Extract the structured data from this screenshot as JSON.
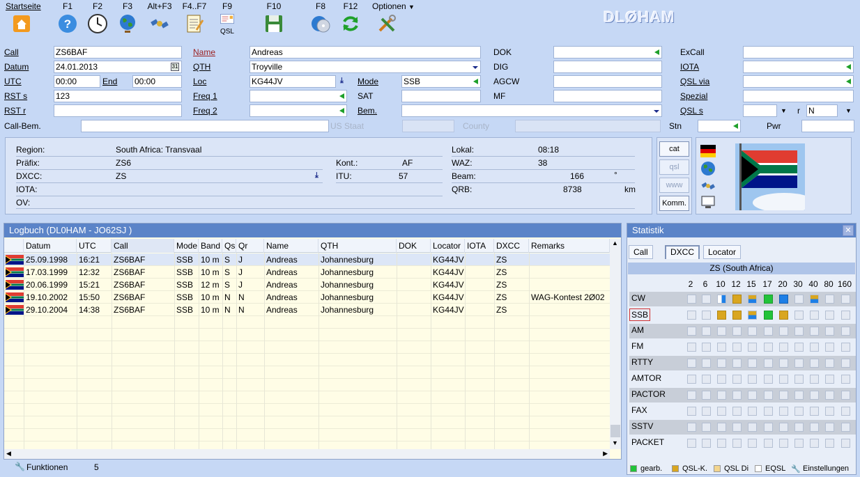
{
  "toolbar": {
    "items": [
      {
        "key": "Startseite",
        "icon": "home-icon"
      },
      {
        "key": "F1",
        "icon": "help-icon"
      },
      {
        "key": "F2",
        "icon": "clock-icon"
      },
      {
        "key": "F3",
        "icon": "globe-icon"
      },
      {
        "key": "Alt+F3",
        "icon": "satellite-icon"
      },
      {
        "key": "F4..F7",
        "icon": "notepad-icon"
      },
      {
        "key": "F9",
        "icon": "qsl-card-icon",
        "sub": "QSL"
      },
      {
        "key": "F10",
        "icon": "save-icon"
      },
      {
        "key": "F8",
        "icon": "cd-icon"
      },
      {
        "key": "F12",
        "icon": "refresh-icon"
      },
      {
        "key": "Optionen",
        "icon": "tools-icon"
      }
    ],
    "brand": "DLØHAM"
  },
  "form": {
    "call_label": "Call",
    "call": "ZS6BAF",
    "datum_label": "Datum",
    "datum": "24.01.2013",
    "utc_label": "UTC",
    "utc": "00:00",
    "end_label": "End",
    "end": "00:00",
    "rsts_label": "RST s",
    "rsts": "123",
    "rstr_label": "RST r",
    "rstr": "",
    "callbem_label": "Call-Bem.",
    "callbem": "",
    "name_label": "Name",
    "name": "Andreas",
    "qth_label": "QTH",
    "qth": "Troyville",
    "loc_label": "Loc",
    "loc": "KG44JV",
    "mode_label": "Mode",
    "mode": "SSB",
    "freq1_label": "Freq 1",
    "freq1": "",
    "sat_label": "SAT",
    "sat": "",
    "freq2_label": "Freq 2",
    "freq2": "",
    "bem_label": "Bem.",
    "bem": "",
    "usstaat_label": "US Staat",
    "usstaat": "",
    "county_label": "County",
    "county": "",
    "dok_label": "DOK",
    "dok": "",
    "dig_label": "DIG",
    "dig": "",
    "agcw_label": "AGCW",
    "agcw": "",
    "mf_label": "MF",
    "mf": "",
    "excall_label": "ExCall",
    "excall": "",
    "iota_label": "IOTA",
    "iota": "",
    "qslvia_label": "QSL via",
    "qslvia": "",
    "spezial_label": "Spezial",
    "spezial": "",
    "qsls_label": "QSL s",
    "qsls": "",
    "r_label": "r",
    "qslr": "N",
    "stn_label": "Stn",
    "stn": "",
    "pwr_label": "Pwr",
    "pwr": ""
  },
  "info": {
    "region_label": "Region:",
    "region": "South Africa: Transvaal",
    "praefix_label": "Präfix:",
    "praefix": "ZS6",
    "dxcc_label": "DXCC:",
    "dxcc": "ZS",
    "iota_label": "IOTA:",
    "iota": "",
    "ov_label": "OV:",
    "ov": "",
    "kont_label": "Kont.:",
    "kont": "AF",
    "itu_label": "ITU:",
    "itu": "57",
    "lokal_label": "Lokal:",
    "lokal": "08:18",
    "waz_label": "WAZ:",
    "waz": "38",
    "beam_label": "Beam:",
    "beam": "166",
    "beam_unit": "°",
    "qrb_label": "QRB:",
    "qrb": "8738",
    "qrb_unit": "km"
  },
  "side_buttons": [
    "cat",
    "qsl",
    "www",
    "Komm."
  ],
  "logbook": {
    "title": "Logbuch  (DL0HAM - JO62SJ )",
    "columns": [
      "Datum",
      "UTC",
      "Call",
      "Mode",
      "Band",
      "Qs",
      "Qr",
      "Name",
      "QTH",
      "DOK",
      "Locator",
      "IOTA",
      "DXCC",
      "Remarks"
    ],
    "rows": [
      [
        "25.09.1998",
        "16:21",
        "ZS6BAF",
        "SSB",
        "10 m",
        "S",
        "J",
        "Andreas",
        "Johannesburg",
        "",
        "KG44JV",
        "",
        "ZS",
        ""
      ],
      [
        "17.03.1999",
        "12:32",
        "ZS6BAF",
        "SSB",
        "10 m",
        "S",
        "J",
        "Andreas",
        "Johannesburg",
        "",
        "KG44JV",
        "",
        "ZS",
        ""
      ],
      [
        "20.06.1999",
        "15:21",
        "ZS6BAF",
        "SSB",
        "12 m",
        "S",
        "J",
        "Andreas",
        "Johannesburg",
        "",
        "KG44JV",
        "",
        "ZS",
        ""
      ],
      [
        "19.10.2002",
        "15:50",
        "ZS6BAF",
        "SSB",
        "10 m",
        "N",
        "N",
        "Andreas",
        "Johannesburg",
        "",
        "KG44JV",
        "",
        "ZS",
        "WAG-Kontest 2Ø02"
      ],
      [
        "29.10.2004",
        "14:38",
        "ZS6BAF",
        "SSB",
        "10 m",
        "N",
        "N",
        "Andreas",
        "Johannesburg",
        "",
        "KG44JV",
        "",
        "ZS",
        ""
      ]
    ]
  },
  "status": {
    "label": "Funktionen",
    "count": "5"
  },
  "statistik": {
    "title": "Statistik",
    "tabs": [
      "Call",
      "DXCC",
      "Locator"
    ],
    "country": "ZS (South Africa)",
    "bands": [
      "2",
      "6",
      "10",
      "12",
      "15",
      "17",
      "20",
      "30",
      "40",
      "80",
      "160"
    ],
    "modes": [
      {
        "name": "CW",
        "cells": [
          "",
          "",
          "wb",
          "y",
          "yb",
          "g",
          "b",
          "",
          "yb",
          "",
          ""
        ]
      },
      {
        "name": "SSB",
        "cells": [
          "",
          "",
          "y",
          "y",
          "yb",
          "g",
          "y",
          "",
          "",
          "",
          ""
        ]
      },
      {
        "name": "AM",
        "cells": [
          "",
          "",
          "",
          "",
          "",
          "",
          "",
          "",
          "",
          "",
          ""
        ]
      },
      {
        "name": "FM",
        "cells": [
          "",
          "",
          "",
          "",
          "",
          "",
          "",
          "",
          "",
          "",
          ""
        ]
      },
      {
        "name": "RTTY",
        "cells": [
          "",
          "",
          "",
          "",
          "",
          "",
          "",
          "",
          "",
          "",
          ""
        ]
      },
      {
        "name": "AMTOR",
        "cells": [
          "",
          "",
          "",
          "",
          "",
          "",
          "",
          "",
          "",
          "",
          ""
        ]
      },
      {
        "name": "PACTOR",
        "cells": [
          "",
          "",
          "",
          "",
          "",
          "",
          "",
          "",
          "",
          "",
          ""
        ]
      },
      {
        "name": "FAX",
        "cells": [
          "",
          "",
          "",
          "",
          "",
          "",
          "",
          "",
          "",
          "",
          ""
        ]
      },
      {
        "name": "SSTV",
        "cells": [
          "",
          "",
          "",
          "",
          "",
          "",
          "",
          "",
          "",
          "",
          ""
        ]
      },
      {
        "name": "PACKET",
        "cells": [
          "",
          "",
          "",
          "",
          "",
          "",
          "",
          "",
          "",
          "",
          ""
        ]
      }
    ],
    "legend": [
      {
        "label": "gearb.",
        "color": "#22c33a"
      },
      {
        "label": "QSL-K.",
        "color": "#d9a620"
      },
      {
        "label": "QSL Di",
        "color": "#f3d58e"
      },
      {
        "label": "EQSL",
        "color": "#ffffff"
      },
      {
        "label": "Einstellungen",
        "icon": "settings-icon"
      }
    ]
  }
}
